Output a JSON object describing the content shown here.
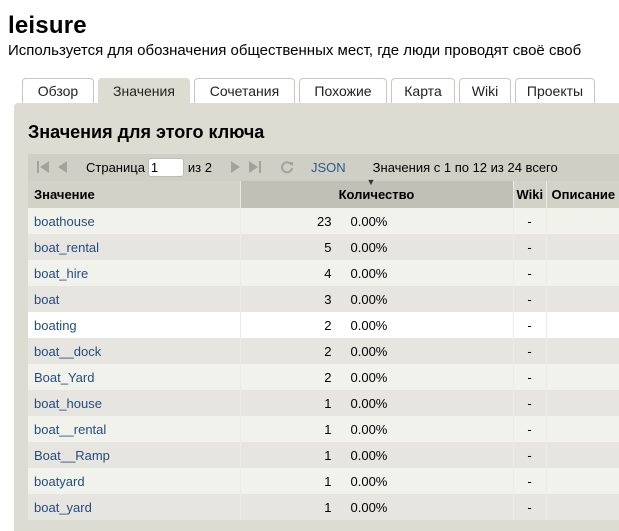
{
  "page": {
    "title": "leisure",
    "description": "Используется для обозначения общественных мест, где люди проводят своё своб"
  },
  "tabs": [
    {
      "label": "Обзор",
      "active": false
    },
    {
      "label": "Значения",
      "active": true
    },
    {
      "label": "Сочетания",
      "active": false
    },
    {
      "label": "Похожие",
      "active": false
    },
    {
      "label": "Карта",
      "active": false
    },
    {
      "label": "Wiki",
      "active": false
    },
    {
      "label": "Проекты",
      "active": false
    }
  ],
  "panel": {
    "title": "Значения для этого ключа"
  },
  "pager": {
    "first_icon": "first-page-icon",
    "prev_icon": "prev-page-icon",
    "next_icon": "next-page-icon",
    "last_icon": "last-page-icon",
    "reload_icon": "reload-icon",
    "page_label": "Страница",
    "page_value": "1",
    "of_label": "из 2",
    "json_label": "JSON",
    "summary": "Значения с 1 по 12 из 24 всего"
  },
  "table": {
    "headers": {
      "value": "Значение",
      "count": "Количество",
      "wiki": "Wiki",
      "desc": "Описание"
    },
    "rows": [
      {
        "value": "boathouse",
        "count": "23",
        "percent": "0.00%",
        "wiki": "-"
      },
      {
        "value": "boat_rental",
        "count": "5",
        "percent": "0.00%",
        "wiki": "-"
      },
      {
        "value": "boat_hire",
        "count": "4",
        "percent": "0.00%",
        "wiki": "-"
      },
      {
        "value": "boat",
        "count": "3",
        "percent": "0.00%",
        "wiki": "-"
      },
      {
        "value": "boating",
        "count": "2",
        "percent": "0.00%",
        "wiki": "-"
      },
      {
        "value": "boat__dock",
        "count": "2",
        "percent": "0.00%",
        "wiki": "-"
      },
      {
        "value": "Boat_Yard",
        "count": "2",
        "percent": "0.00%",
        "wiki": "-"
      },
      {
        "value": "boat_house",
        "count": "1",
        "percent": "0.00%",
        "wiki": "-"
      },
      {
        "value": "boat__rental",
        "count": "1",
        "percent": "0.00%",
        "wiki": "-"
      },
      {
        "value": "Boat__Ramp",
        "count": "1",
        "percent": "0.00%",
        "wiki": "-"
      },
      {
        "value": "boatyard",
        "count": "1",
        "percent": "0.00%",
        "wiki": "-"
      },
      {
        "value": "boat_yard",
        "count": "1",
        "percent": "0.00%",
        "wiki": "-"
      }
    ]
  }
}
